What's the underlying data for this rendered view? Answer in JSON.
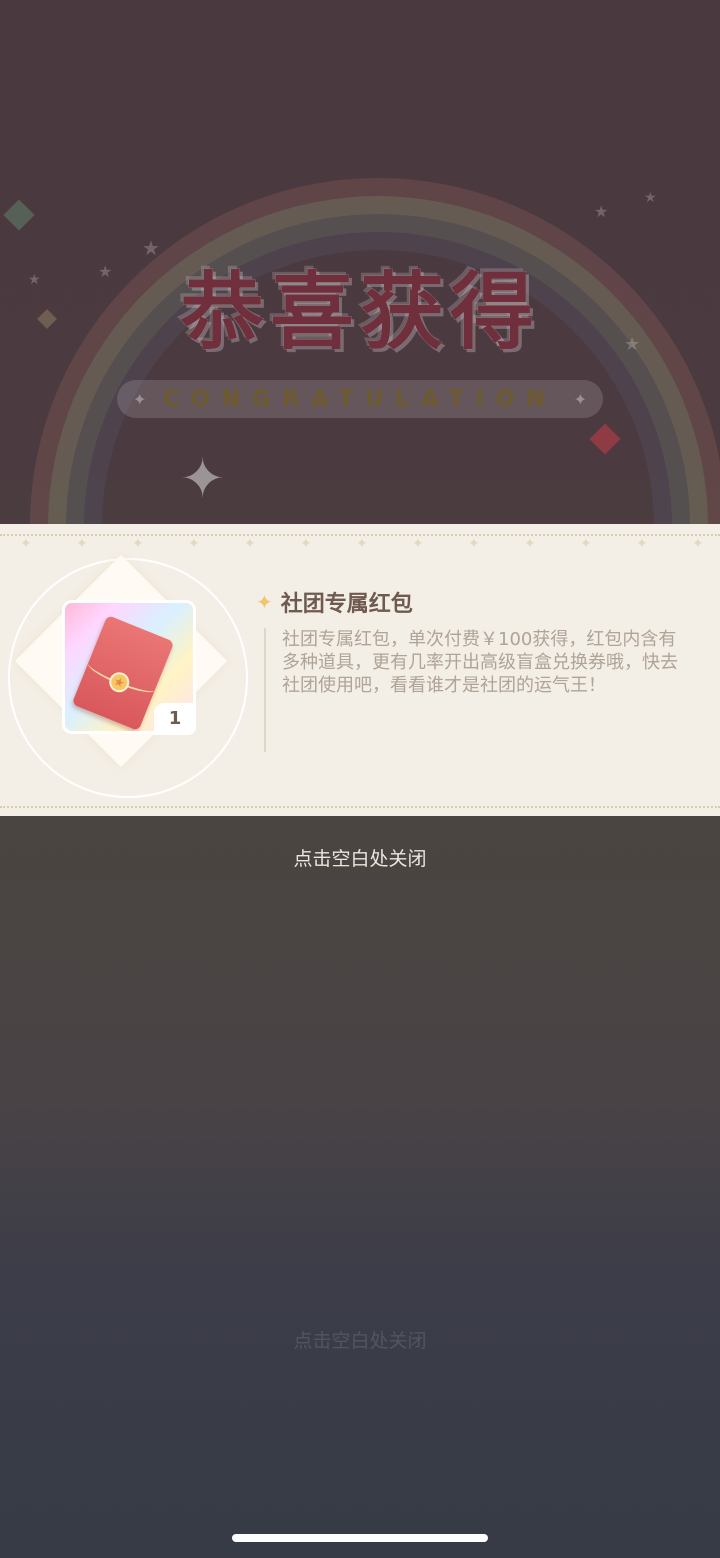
{
  "banner": {
    "title": "恭喜获得",
    "subtitle": "CONGRATULATION"
  },
  "reward": {
    "item_name": "社团专属红包",
    "description": "社团专属红包，单次付费￥100获得，红包内含有多种道具，更有几率开出高级盲盒兑换券哦，快去社团使用吧，看看谁才是社团的运气王！",
    "quantity": "1",
    "icon": "red-envelope-icon"
  },
  "footer": {
    "close_hint": "点击空白处关闭"
  },
  "colors": {
    "card_bg": "#f4efe6",
    "title": "#6f2f3c",
    "item_name": "#6e5a4e",
    "description": "#b0a397",
    "accent_star": "#f0c56b"
  }
}
